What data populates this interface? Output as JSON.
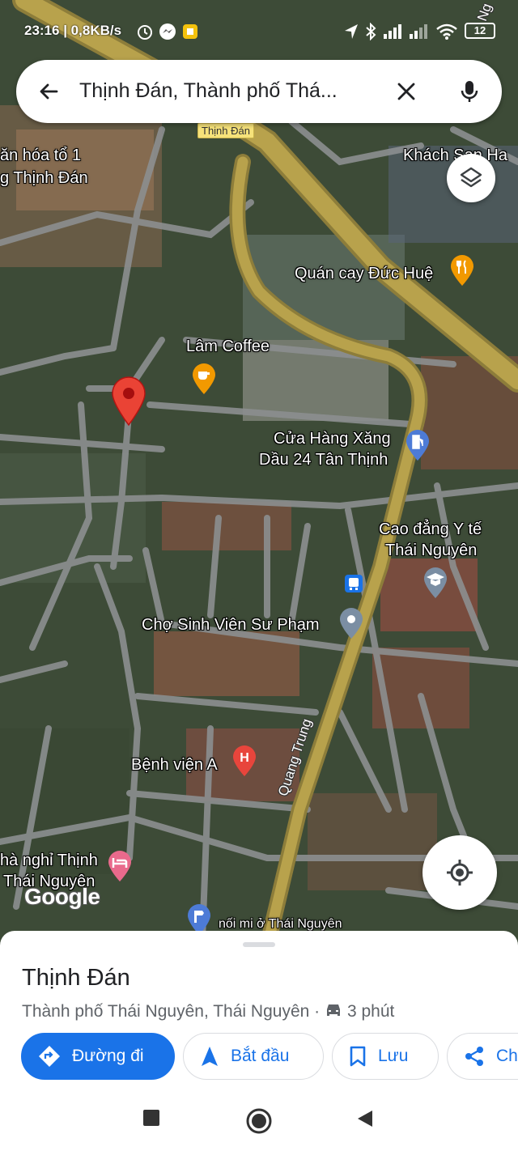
{
  "status_bar": {
    "time_speed": "23:16 | 0,8KB/s",
    "battery": "12"
  },
  "search": {
    "query": "Thịnh Đán, Thành phố Thá...",
    "back_icon": "arrow-back-icon",
    "clear_icon": "close-icon",
    "mic_icon": "mic-icon"
  },
  "map": {
    "shield_label": "Thịnh Đán",
    "labels": [
      "ăn hóa tổ 1",
      "g Thịnh Đán",
      "Khách Sạn Ha",
      "Quán cay Đức Huệ",
      "Lâm Coffee",
      "Cửa Hàng Xăng",
      "Dầu 24 Tân Thịnh",
      "Cao đẳng Y tế",
      "Thái Nguyên",
      "Chợ Sinh Viên Sư Phạm",
      "Bệnh viện A",
      "hà nghỉ Thịnh",
      "Thái Nguyên",
      "nối mi ở Thái Nguyên"
    ],
    "road_label": "Quang Trung",
    "corner_label": "Ng",
    "google_logo": "Google"
  },
  "place": {
    "title": "Thịnh Đán",
    "subtitle": "Thành phố Thái Nguyên, Thái Nguyên · ",
    "drive_time": "3 phút"
  },
  "actions": {
    "directions": "Đường đi",
    "start": "Bắt đầu",
    "save": "Lưu",
    "share": "Ch"
  },
  "colors": {
    "accent": "#1a73e8",
    "marker": "#ea4335",
    "highway": "#b8a24c"
  }
}
